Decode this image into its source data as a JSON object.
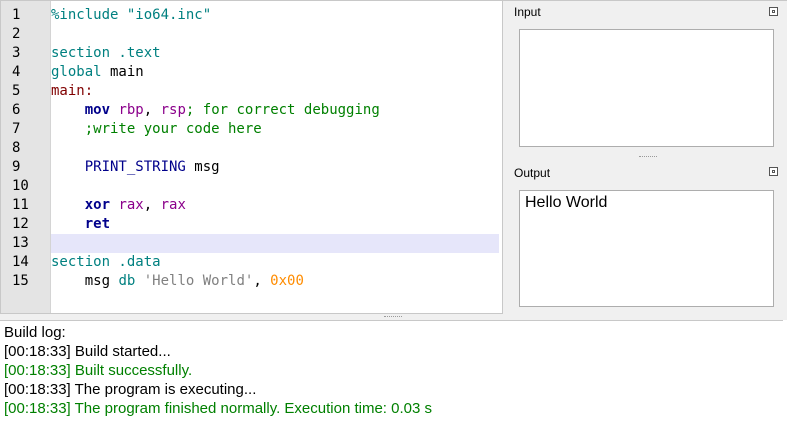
{
  "editor": {
    "line_numbers": [
      "1",
      "2",
      "3",
      "4",
      "5",
      "6",
      "7",
      "8",
      "9",
      "10",
      "11",
      "12",
      "13",
      "14",
      "15"
    ],
    "current_line": 13,
    "lines": [
      [
        {
          "t": "%include \"io64.inc\"",
          "c": "c-dir"
        }
      ],
      [],
      [
        {
          "t": "section .text",
          "c": "c-dir"
        }
      ],
      [
        {
          "t": "global",
          "c": "c-dir"
        },
        {
          "t": " main",
          "c": "c-plain"
        }
      ],
      [
        {
          "t": "main:",
          "c": "c-label"
        }
      ],
      [
        {
          "t": "    ",
          "c": "c-plain"
        },
        {
          "t": "mov",
          "c": "c-kw"
        },
        {
          "t": " ",
          "c": "c-plain"
        },
        {
          "t": "rbp",
          "c": "c-reg"
        },
        {
          "t": ", ",
          "c": "c-plain"
        },
        {
          "t": "rsp",
          "c": "c-reg"
        },
        {
          "t": "; for correct debugging",
          "c": "c-comment"
        }
      ],
      [
        {
          "t": "    ;write your code here",
          "c": "c-comment"
        }
      ],
      [],
      [
        {
          "t": "    ",
          "c": "c-plain"
        },
        {
          "t": "PRINT_STRING",
          "c": "c-macro"
        },
        {
          "t": " msg",
          "c": "c-plain"
        }
      ],
      [],
      [
        {
          "t": "    ",
          "c": "c-plain"
        },
        {
          "t": "xor",
          "c": "c-kw"
        },
        {
          "t": " ",
          "c": "c-plain"
        },
        {
          "t": "rax",
          "c": "c-reg"
        },
        {
          "t": ", ",
          "c": "c-plain"
        },
        {
          "t": "rax",
          "c": "c-reg"
        }
      ],
      [
        {
          "t": "    ",
          "c": "c-plain"
        },
        {
          "t": "ret",
          "c": "c-kw"
        }
      ],
      [],
      [
        {
          "t": "section .data",
          "c": "c-dir"
        }
      ],
      [
        {
          "t": "    msg ",
          "c": "c-plain"
        },
        {
          "t": "db",
          "c": "c-dir"
        },
        {
          "t": " ",
          "c": "c-plain"
        },
        {
          "t": "'Hello World'",
          "c": "c-str"
        },
        {
          "t": ", ",
          "c": "c-plain"
        },
        {
          "t": "0x00",
          "c": "c-num"
        }
      ]
    ]
  },
  "input_panel": {
    "title": "Input",
    "value": ""
  },
  "output_panel": {
    "title": "Output",
    "value": "Hello World"
  },
  "build_log": {
    "lines": [
      {
        "text": "Build log:",
        "color": "black"
      },
      {
        "text": "[00:18:33] Build started...",
        "color": "black"
      },
      {
        "text": "[00:18:33] Built successfully.",
        "color": "green"
      },
      {
        "text": "[00:18:33] The program is executing...",
        "color": "black"
      },
      {
        "text": "[00:18:33] The program finished normally. Execution time: 0.03 s",
        "color": "green"
      }
    ]
  },
  "icons": {
    "maximize": "maximize-icon"
  }
}
